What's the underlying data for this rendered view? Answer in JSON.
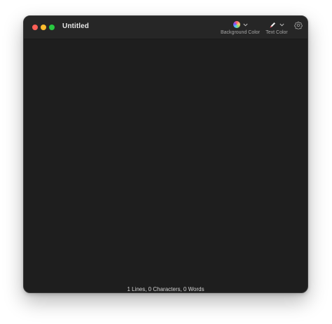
{
  "window": {
    "title": "Untitled"
  },
  "toolbar": {
    "background_color_label": "Background Color",
    "text_color_label": "Text Color",
    "background_icon": "color-wheel-icon",
    "text_icon": "pen-icon",
    "settings_icon": "gear-icon"
  },
  "status": {
    "text": "1 Lines, 0 Characters, 0 Words"
  },
  "colors": {
    "window_bg": "#1e1e1e",
    "titlebar_bg": "#262626",
    "close": "#ff5f57",
    "minimize": "#febc2e",
    "maximize": "#28c840"
  }
}
